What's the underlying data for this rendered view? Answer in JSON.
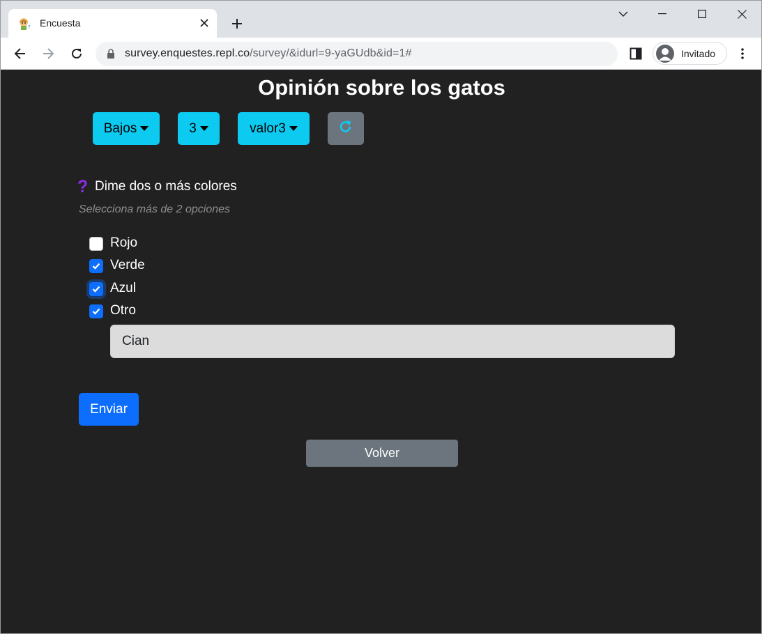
{
  "browser": {
    "tab_title": "Encuesta",
    "url_host": "survey.enquestes.repl.co",
    "url_path": "/survey/&idurl=9-yaGUdb&id=1#",
    "profile_label": "Invitado"
  },
  "page": {
    "title": "Opinión sobre los gatos",
    "dropdowns": [
      {
        "label": "Bajos"
      },
      {
        "label": "3"
      },
      {
        "label": "valor3"
      }
    ],
    "question": {
      "icon": "question-icon",
      "text": "Dime dos o más colores",
      "hint": "Selecciona más de 2 opciones",
      "options": [
        {
          "label": "Rojo",
          "checked": false
        },
        {
          "label": "Verde",
          "checked": true
        },
        {
          "label": "Azul",
          "checked": true,
          "focused": true
        },
        {
          "label": "Otro",
          "checked": true
        }
      ],
      "other_value": "Cian"
    },
    "submit_label": "Enviar",
    "back_label": "Volver"
  },
  "colors": {
    "page_bg": "#212121",
    "dropdown_bg": "#0dcaf0",
    "primary": "#0d6efd",
    "secondary": "#6c757d",
    "question_icon": "#8a2be2",
    "refresh_icon": "#0dcaf0"
  }
}
